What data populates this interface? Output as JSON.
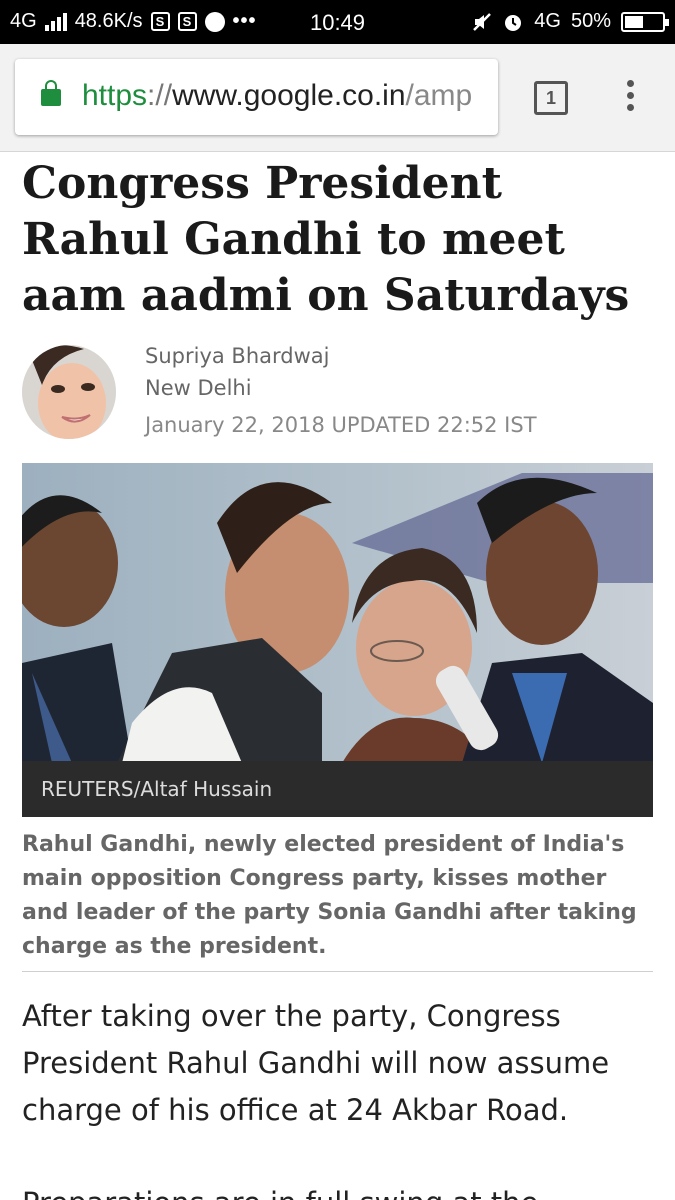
{
  "status_bar": {
    "network": "4G",
    "speed": "48.6K/s",
    "notif_1": "S",
    "notif_2": "S",
    "more": "•••",
    "time": "10:49",
    "network_right": "4G",
    "battery_percent": "50%",
    "battery_level": 0.5,
    "icons": [
      "signal-icon",
      "notification-icon",
      "mute-icon",
      "alarm-icon",
      "battery-icon"
    ]
  },
  "browser": {
    "url_scheme": "https",
    "url_sep": "://",
    "url_host": "www.google.co.in",
    "url_path": "/amp",
    "tab_count": "1",
    "icons": [
      "lock-icon",
      "tab-switcher-icon",
      "overflow-menu-icon"
    ],
    "accent_color": "#1e8e3e"
  },
  "article": {
    "headline": "Congress President Rahul Gandhi to meet aam aadmi on Saturdays",
    "author": "Supriya Bhardwaj",
    "location": "New Delhi",
    "date": "January 22, 2018 UPDATED 22:52 IST",
    "photo_credit": "REUTERS/Altaf Hussain",
    "caption": "Rahul Gandhi, newly elected president of India's main opposition Congress party, kisses mother and leader of the party Sonia Gandhi after taking charge as the president.",
    "paragraph_1": "After taking over the party, Congress President Rahul Gandhi will now assume charge of his office at 24 Akbar Road.",
    "paragraph_2": "Preparations are in full swing at the"
  }
}
